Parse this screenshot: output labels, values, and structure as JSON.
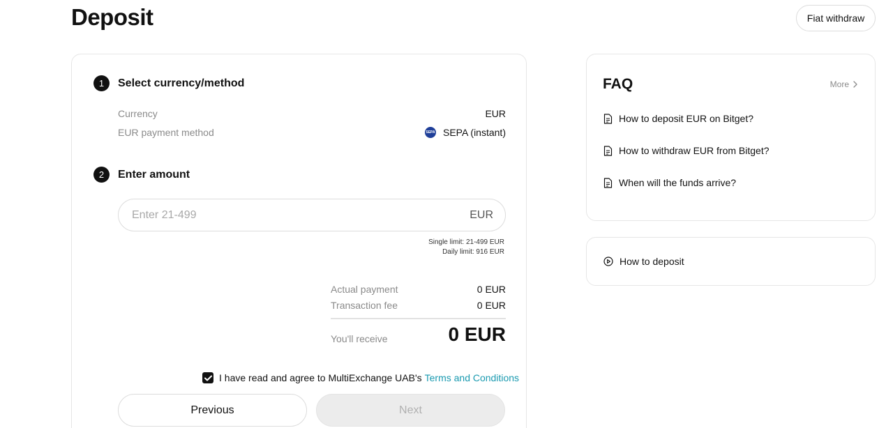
{
  "header": {
    "title": "Deposit",
    "fiat_withdraw_label": "Fiat withdraw"
  },
  "step1": {
    "number": "1",
    "title": "Select currency/method",
    "currency_label": "Currency",
    "currency_value": "EUR",
    "method_label": "EUR payment method",
    "method_icon_text": "SEPA",
    "method_value": "SEPA (instant)"
  },
  "step2": {
    "number": "2",
    "title": "Enter amount",
    "amount_placeholder": "Enter 21-499",
    "amount_value": "",
    "amount_unit": "EUR",
    "single_limit": "Single limit: 21-499 EUR",
    "daily_limit": "Daily limit: 916 EUR"
  },
  "summary": {
    "actual_payment_label": "Actual payment",
    "actual_payment_value": "0 EUR",
    "fee_label": "Transaction fee",
    "fee_value": "0 EUR",
    "receive_label": "You'll receive",
    "receive_value": "0 EUR"
  },
  "agreement": {
    "checked": true,
    "text": "I have read and agree to MultiExchange UAB's",
    "link_text": "Terms and Conditions"
  },
  "buttons": {
    "previous": "Previous",
    "next": "Next"
  },
  "faq": {
    "title": "FAQ",
    "more_label": "More",
    "items": [
      {
        "label": "How to deposit EUR on Bitget?"
      },
      {
        "label": "How to withdraw EUR from Bitget?"
      },
      {
        "label": "When will the funds arrive?"
      }
    ]
  },
  "howto": {
    "label": "How to deposit"
  },
  "colors": {
    "accent_link": "#1a9ab0",
    "sepa_blue": "#1f3f99",
    "dark": "#111111"
  },
  "icons": {
    "faq_item": "document-icon",
    "more": "chevron-right-icon",
    "howto": "play-circle-icon",
    "checkbox": "checkmark-icon"
  }
}
